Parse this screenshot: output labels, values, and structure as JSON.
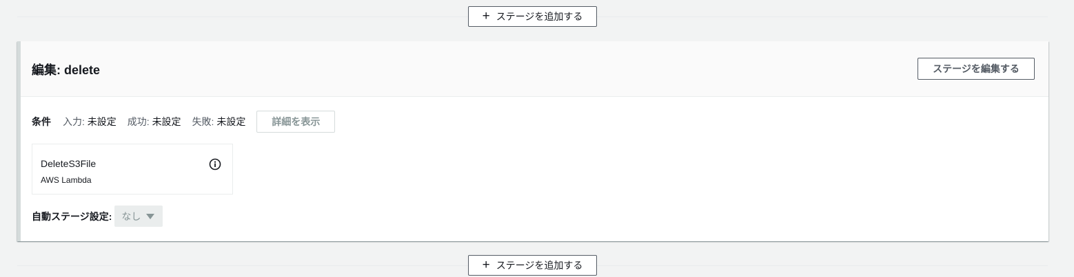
{
  "add_stage_label": "ステージを追加する",
  "stage": {
    "title": "編集: delete",
    "edit_button": "ステージを編集する",
    "conditions": {
      "heading": "条件",
      "input_key": "入力:",
      "input_value": "未設定",
      "success_key": "成功:",
      "success_value": "未設定",
      "failure_key": "失敗:",
      "failure_value": "未設定",
      "details_button": "詳細を表示"
    },
    "action": {
      "name": "DeleteS3File",
      "provider": "AWS Lambda",
      "icon": "info-icon"
    },
    "auto_stage": {
      "label": "自動ステージ設定:",
      "selected": "なし"
    }
  },
  "colors": {
    "background": "#f2f3f3",
    "border_dark": "#545b64",
    "disabled_text": "#879596"
  }
}
